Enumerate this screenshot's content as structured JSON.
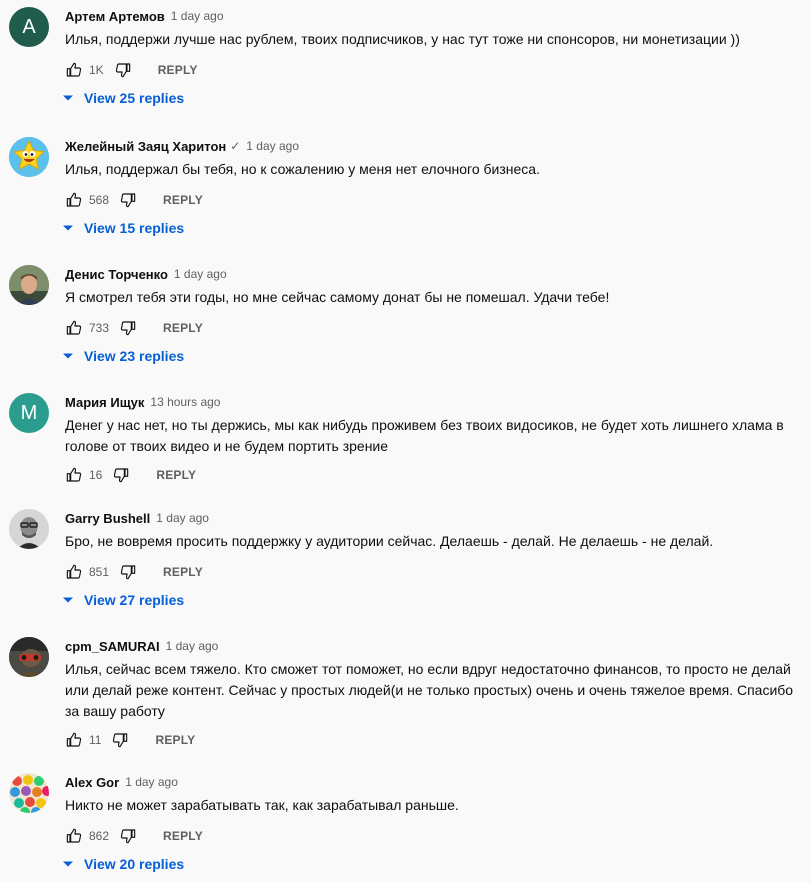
{
  "reply_label": "REPLY",
  "comments": [
    {
      "author": "Артем Артемов",
      "time": "1 day ago",
      "text": "Илья, поддержи лучше нас рублем, твоих подписчиков, у нас тут тоже ни спонсоров, ни монетизации ))",
      "likes": "1K",
      "avatar_letter": "A",
      "avatar_color": "#1f5c4b",
      "view_replies": "View 25 replies"
    },
    {
      "author": "Желейный Заяц Харитон",
      "verified": "✓",
      "time": "1 day ago",
      "text": "Илья, поддержал бы тебя, но к сожалению у меня нет елочного бизнеса.",
      "likes": "568",
      "avatar_icon": "yellow-cartoon-star-avatar",
      "view_replies": "View 15 replies"
    },
    {
      "author": "Денис Торченко",
      "time": "1 day ago",
      "text": "Я смотрел тебя эти годы, но мне сейчас самому донат бы не помешал. Удачи тебе!",
      "likes": "733",
      "avatar_icon": "photo-avatar",
      "view_replies": "View 23 replies"
    },
    {
      "author": "Мария Ищук",
      "time": "13 hours ago",
      "text": "Денег у нас нет, но ты держись, мы как нибудь проживем без твоих видосиков, не будет хоть лишнего хлама в голове от твоих видео и не будем портить зрение",
      "likes": "16",
      "avatar_letter": "M",
      "avatar_color": "#2a9d8f"
    },
    {
      "author": "Garry Bushell",
      "time": "1 day ago",
      "text": "Бро, не вовремя просить поддержку у аудитории сейчас. Делаешь - делай. Не делаешь - не делай.",
      "likes": "851",
      "avatar_icon": "photo-avatar",
      "view_replies": "View 27 replies"
    },
    {
      "author": "cpm_SAMURAI",
      "time": "1 day ago",
      "text": "Илья, сейчас всем тяжело. Кто сможет тот поможет, но если вдруг недостаточно финансов, то просто не делай или делай реже контент. Сейчас у простых людей(и не только простых) очень и очень тяжелое время. Спасибо за вашу работу",
      "likes": "11",
      "avatar_icon": "photo-avatar"
    },
    {
      "author": "Alex Gor",
      "time": "1 day ago",
      "text": "Никто не может зарабатывать так, как зарабатывал раньше.",
      "likes": "862",
      "avatar_icon": "colorful-balls-avatar",
      "view_replies": "View 20 replies"
    }
  ]
}
